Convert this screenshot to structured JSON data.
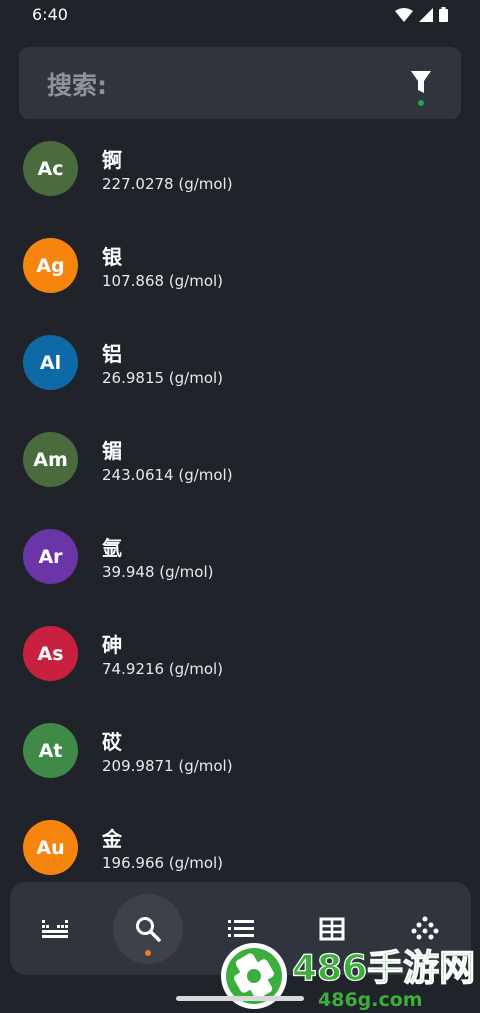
{
  "status_bar": {
    "time": "6:40"
  },
  "search": {
    "label": "搜索:",
    "filter_dot_color": "#2aa14c"
  },
  "elements": [
    {
      "symbol": "Ac",
      "name": "锕",
      "mass": "227.0278 (g/mol)",
      "color": "#4a6b3e"
    },
    {
      "symbol": "Ag",
      "name": "银",
      "mass": "107.868 (g/mol)",
      "color": "#f5850f"
    },
    {
      "symbol": "Al",
      "name": "铝",
      "mass": "26.9815 (g/mol)",
      "color": "#0e6aa6"
    },
    {
      "symbol": "Am",
      "name": "镅",
      "mass": "243.0614 (g/mol)",
      "color": "#4a6b3e"
    },
    {
      "symbol": "Ar",
      "name": "氩",
      "mass": "39.948 (g/mol)",
      "color": "#6a35a6"
    },
    {
      "symbol": "As",
      "name": "砷",
      "mass": "74.9216 (g/mol)",
      "color": "#c8213f"
    },
    {
      "symbol": "At",
      "name": "砹",
      "mass": "209.9871 (g/mol)",
      "color": "#3f8a47"
    },
    {
      "symbol": "Au",
      "name": "金",
      "mass": "196.966 (g/mol)",
      "color": "#f5850f"
    }
  ],
  "bottom_nav": {
    "items": [
      {
        "icon": "periodic-table-icon",
        "active": false
      },
      {
        "icon": "search-icon",
        "active": true
      },
      {
        "icon": "list-icon",
        "active": false
      },
      {
        "icon": "table-grid-icon",
        "active": false
      },
      {
        "icon": "dots-grid-icon",
        "active": false
      }
    ],
    "active_dot_color": "#f07a2a"
  },
  "watermark": {
    "brand": "486手游网",
    "url": "486g.com"
  }
}
